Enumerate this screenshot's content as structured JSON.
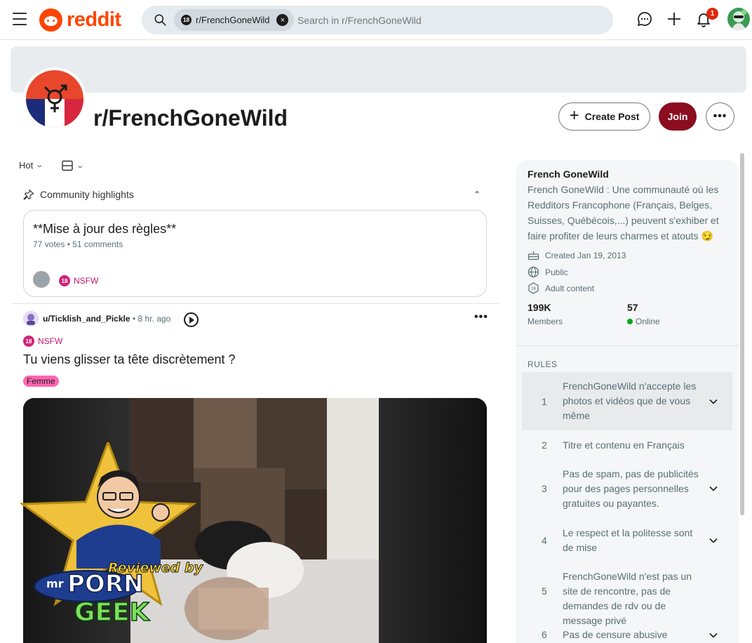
{
  "header": {
    "logo_text": "reddit",
    "search_chip": "r/FrenchGoneWild",
    "search_chip_badge": "18",
    "search_placeholder": "Search in r/FrenchGoneWild",
    "notification_count": "1",
    "icons": [
      "menu-icon",
      "search-icon",
      "chat-icon",
      "plus-icon",
      "bell-icon",
      "user-avatar"
    ]
  },
  "subreddit": {
    "title": "r/FrenchGoneWild",
    "create_post_label": "Create Post",
    "join_label": "Join",
    "more_label": "•••"
  },
  "sort": {
    "label": "Hot"
  },
  "highlights": {
    "heading": "Community highlights",
    "card": {
      "title": "**Mise à jour des règles**",
      "meta": "77 votes • 51 comments",
      "nsfw_label": "NSFW",
      "nsfw_badge": "18"
    }
  },
  "post": {
    "username": "u/Ticklish_and_Pickle",
    "time": "• 8 hr. ago",
    "nsfw_label": "NSFW",
    "nsfw_badge": "18",
    "title": "Tu viens glisser ta tête discrètement ?",
    "flair": "Femme",
    "more_label": "•••"
  },
  "sidebar": {
    "title": "French GoneWild",
    "description": "French GoneWild : Une communauté où les Redditors Francophone (Français, Belges, Suisses, Québécois,...) peuvent s'exhiber et faire profiter de leurs charmes et atouts 😏",
    "created": "Created Jan 19, 2013",
    "visibility": "Public",
    "content_type": "Adult content",
    "members_value": "199K",
    "members_label": "Members",
    "online_value": "57",
    "online_label": "Online",
    "rules_heading": "RULES",
    "rules": [
      {
        "num": "1",
        "text": "FrenchGoneWild n'accepte les photos et vidéos que de vous même",
        "expandable": true
      },
      {
        "num": "2",
        "text": "Titre et contenu en Français",
        "expandable": false
      },
      {
        "num": "3",
        "text": "Pas de spam, pas de publicités pour des pages personnelles gratuites ou payantes.",
        "expandable": true
      },
      {
        "num": "4",
        "text": "Le respect et la politesse sont de mise",
        "expandable": true
      },
      {
        "num": "5",
        "text": "FrenchGoneWild n'est pas un site de rencontre, pas de demandes de rdv ou de message privé",
        "expandable": false
      },
      {
        "num": "6",
        "text": "Pas de censure abusive",
        "expandable": true
      }
    ]
  },
  "watermark": {
    "line1": "Reviewed by",
    "line2": "mr",
    "line3": "PORN",
    "line4": "GEEK"
  },
  "colors": {
    "brand": "#ff4500",
    "join_button": "#8b0d1f",
    "nsfw": "#d1247a",
    "flair": "#ff66b2",
    "online": "#01a816"
  }
}
